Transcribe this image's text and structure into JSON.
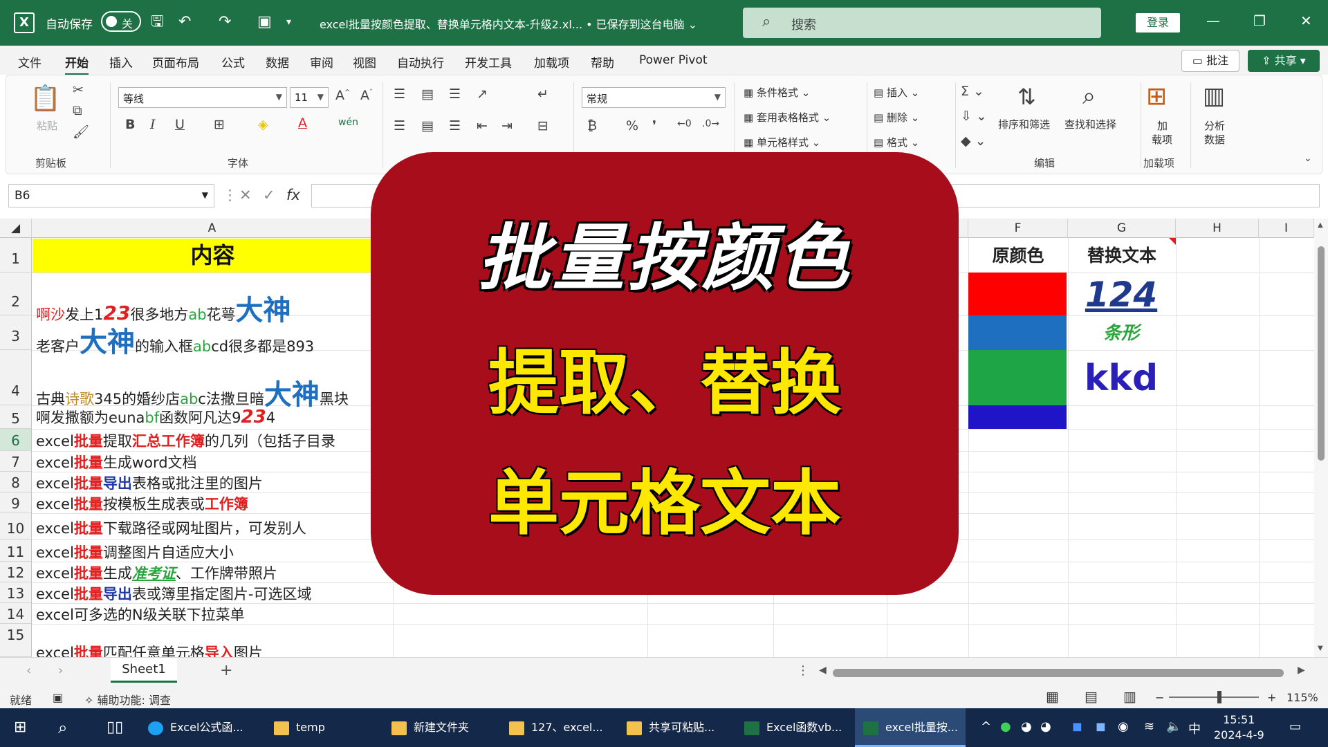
{
  "titlebar": {
    "autosave_label": "自动保存",
    "autosave_state": "关",
    "doc_title": "excel批量按颜色提取、替换单元格内文本-升级2.xl... • 已保存到这台电脑 ⌄",
    "search_placeholder": "搜索",
    "login": "登录"
  },
  "menu": {
    "tabs": [
      "文件",
      "开始",
      "插入",
      "页面布局",
      "公式",
      "数据",
      "审阅",
      "视图",
      "自动执行",
      "开发工具",
      "加载项",
      "帮助",
      "Power Pivot"
    ],
    "active": "开始",
    "comment": "批注",
    "share": "共享"
  },
  "ribbon": {
    "paste": "粘贴",
    "clipboard": "剪贴板",
    "font_name": "等线",
    "font_size": "11",
    "font_group": "字体",
    "number_format": "常规",
    "cond_format": "条件格式",
    "table_format": "套用表格格式",
    "cell_style": "单元格样式",
    "insert": "插入",
    "delete": "删除",
    "format": "格式",
    "cells_group_partial": "格",
    "sort_filter": "排序和筛选",
    "find_select": "查找和选择",
    "edit_group": "编辑",
    "addin_1": "加",
    "addin_2": "载项",
    "addin_group": "加载项",
    "analyze_1": "分析",
    "analyze_2": "数据"
  },
  "formula_bar": {
    "name_box": "B6",
    "fx": "fx",
    "value": ""
  },
  "grid": {
    "columns": [
      "A",
      "F",
      "G",
      "H",
      "I"
    ],
    "rows": [
      "1",
      "2",
      "3",
      "4",
      "5",
      "6",
      "7",
      "8",
      "9",
      "10",
      "11",
      "12",
      "13",
      "14",
      "15"
    ],
    "selected_row": "6",
    "a1": "内容",
    "r2": [
      "啊沙",
      "发上1",
      "23",
      "很多地方",
      "ab",
      "花萼",
      "大神"
    ],
    "r3": [
      "老客户",
      "大神",
      "的输入框",
      "ab",
      "cd很多都是893"
    ],
    "r4": [
      "古典",
      "诗歌",
      "345的婚纱店",
      "ab",
      "c法撒旦暗",
      "大神",
      "黑块"
    ],
    "r5": [
      "啊发撒额为euna",
      "bf",
      "函数阿凡达9",
      "23",
      "4"
    ],
    "r6": [
      "excel",
      "批量",
      "提取",
      "汇总工作簿",
      "的几列（包括子目录"
    ],
    "r7": [
      "excel",
      "批量",
      "生成word文档"
    ],
    "r8": [
      "excel",
      "批量",
      "导出",
      "表格或批注里的图片"
    ],
    "r9": [
      "excel",
      "批量",
      "按模板生成表或",
      "工作簿"
    ],
    "r10": [
      "excel",
      "批量",
      "下载路径或网址图片，可发别人"
    ],
    "r11": [
      "excel",
      "批量",
      "调整图片自适应大小"
    ],
    "r12": [
      "excel",
      "批量",
      "生成",
      "准考证",
      "、工作牌带照片"
    ],
    "r13": [
      "excel",
      "批量",
      "导出",
      "表或簿里指定图片-可选区域"
    ],
    "r14": [
      "excel可多选的N级关联下拉菜单"
    ],
    "r15": [
      "excel",
      "批量",
      "匹配任意单元格",
      "导入",
      "图片"
    ],
    "f1": "原颜色",
    "g1": "替换文本",
    "g2": "124",
    "g3": "条形",
    "g4": "kkd",
    "swatches": [
      "#ff0000",
      "#1f6fc0",
      "#1ea546",
      "#2014c8"
    ]
  },
  "overlay": {
    "line1": "批量按颜色",
    "line2": "提取、替换",
    "line3": "单元格文本"
  },
  "sheet": {
    "tab": "Sheet1",
    "add": "+"
  },
  "status": {
    "ready": "就绪",
    "accessibility": "辅助功能: 调查",
    "zoom": "115%"
  },
  "taskbar": {
    "items": [
      "Excel公式函...",
      "temp",
      "新建文件夹",
      "127、excel...",
      "共享可粘贴...",
      "Excel函数vb...",
      "excel批量按..."
    ],
    "ime": "中",
    "time": "15:51",
    "date": "2024-4-9"
  }
}
